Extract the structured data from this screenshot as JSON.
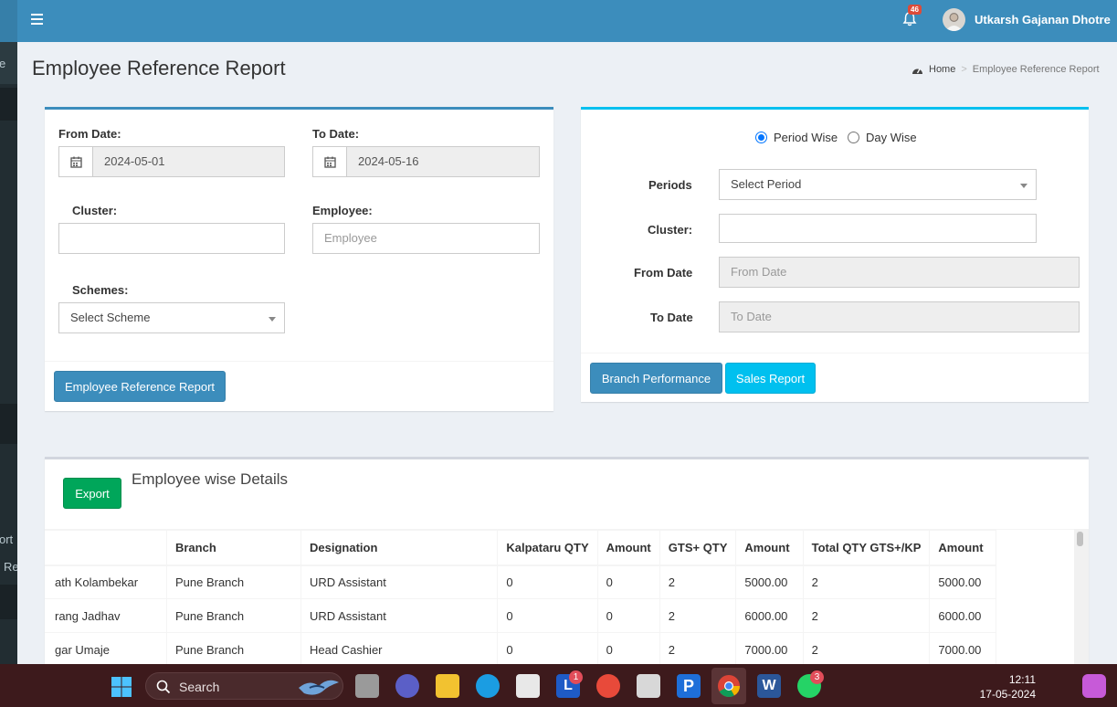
{
  "header": {
    "notification_count": "46",
    "user_name": "Utkarsh Gajanan Dhotre"
  },
  "sidebar_partial": {
    "item_1": "e",
    "item_2": "ort",
    "item_3": "Re"
  },
  "page": {
    "title": "Employee Reference Report",
    "breadcrumb_home": "Home",
    "breadcrumb_current": "Employee Reference Report"
  },
  "left_form": {
    "from_date_label": "From Date:",
    "from_date_value": "2024-05-01",
    "to_date_label": "To Date:",
    "to_date_value": "2024-05-16",
    "cluster_label": "Cluster:",
    "employee_label": "Employee:",
    "employee_placeholder": "Employee",
    "schemes_label": "Schemes:",
    "scheme_selected": "Select Scheme",
    "submit_label": "Employee Reference Report"
  },
  "right_form": {
    "period_wise_label": "Period Wise",
    "day_wise_label": "Day Wise",
    "periods_label": "Periods",
    "period_selected": "Select Period",
    "cluster_label": "Cluster:",
    "from_date_label": "From Date",
    "from_date_placeholder": "From Date",
    "to_date_label": "To Date",
    "to_date_placeholder": "To Date",
    "branch_performance_label": "Branch Performance",
    "sales_report_label": "Sales Report"
  },
  "details": {
    "export_label": "Export",
    "title": "Employee wise Details",
    "columns": [
      "",
      "Branch",
      "Designation",
      "Kalpataru QTY",
      "Amount",
      "GTS+ QTY",
      "Amount",
      "Total QTY GTS+/KP",
      "Amount"
    ],
    "rows": [
      [
        "ath Kolambekar",
        "Pune Branch",
        "URD Assistant",
        "0",
        "0",
        "2",
        "5000.00",
        "2",
        "5000.00"
      ],
      [
        "rang Jadhav",
        "Pune Branch",
        "URD Assistant",
        "0",
        "0",
        "2",
        "6000.00",
        "2",
        "6000.00"
      ],
      [
        "gar Umaje",
        "Pune Branch",
        "Head Cashier",
        "0",
        "0",
        "2",
        "7000.00",
        "2",
        "7000.00"
      ]
    ]
  },
  "taskbar": {
    "search_label": "Search",
    "badge_l": "1",
    "badge_whatsapp": "3",
    "time": "12:11",
    "date": "17-05-2024"
  }
}
